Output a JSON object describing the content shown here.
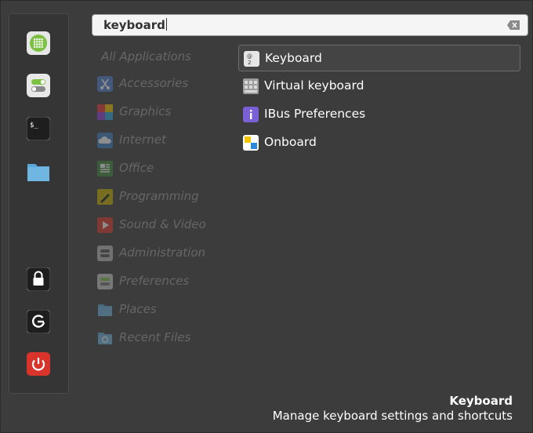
{
  "search": {
    "query": "keyboard"
  },
  "sidebar": {
    "favorites": [
      {
        "name": "mint-menu-app",
        "icon": "grid-icon"
      },
      {
        "name": "system-settings",
        "icon": "toggle-icon"
      },
      {
        "name": "terminal",
        "icon": "terminal-icon",
        "glyph": "$_"
      },
      {
        "name": "files",
        "icon": "folder-icon"
      },
      {
        "name": "lock-screen",
        "icon": "lock-icon"
      },
      {
        "name": "logout",
        "icon": "logout-icon"
      },
      {
        "name": "shutdown",
        "icon": "power-icon"
      }
    ]
  },
  "categories": [
    {
      "label": "All Applications",
      "icon": ""
    },
    {
      "label": "Accessories",
      "icon": "scissors-icon"
    },
    {
      "label": "Graphics",
      "icon": "palette-icon"
    },
    {
      "label": "Internet",
      "icon": "cloud-icon"
    },
    {
      "label": "Office",
      "icon": "document-icon"
    },
    {
      "label": "Programming",
      "icon": "pencil-icon"
    },
    {
      "label": "Sound & Video",
      "icon": "play-icon"
    },
    {
      "label": "Administration",
      "icon": "admin-icon"
    },
    {
      "label": "Preferences",
      "icon": "preferences-icon"
    },
    {
      "label": "Places",
      "icon": "folder-icon"
    },
    {
      "label": "Recent Files",
      "icon": "recent-folder-icon"
    }
  ],
  "results": [
    {
      "label": "Keyboard",
      "icon": "keyboard-icon",
      "selected": true
    },
    {
      "label": "Virtual keyboard",
      "icon": "virtual-keyboard-icon",
      "selected": false
    },
    {
      "label": "IBus Preferences",
      "icon": "info-icon",
      "selected": false
    },
    {
      "label": "Onboard",
      "icon": "onboard-icon",
      "selected": false
    }
  ],
  "description": {
    "title": "Keyboard",
    "text": "Manage keyboard settings and shortcuts"
  },
  "colors": {
    "background": "#3c3c3c",
    "category_text": "#666666",
    "power_red": "#d9342b",
    "mint_green": "#8fce3c"
  }
}
